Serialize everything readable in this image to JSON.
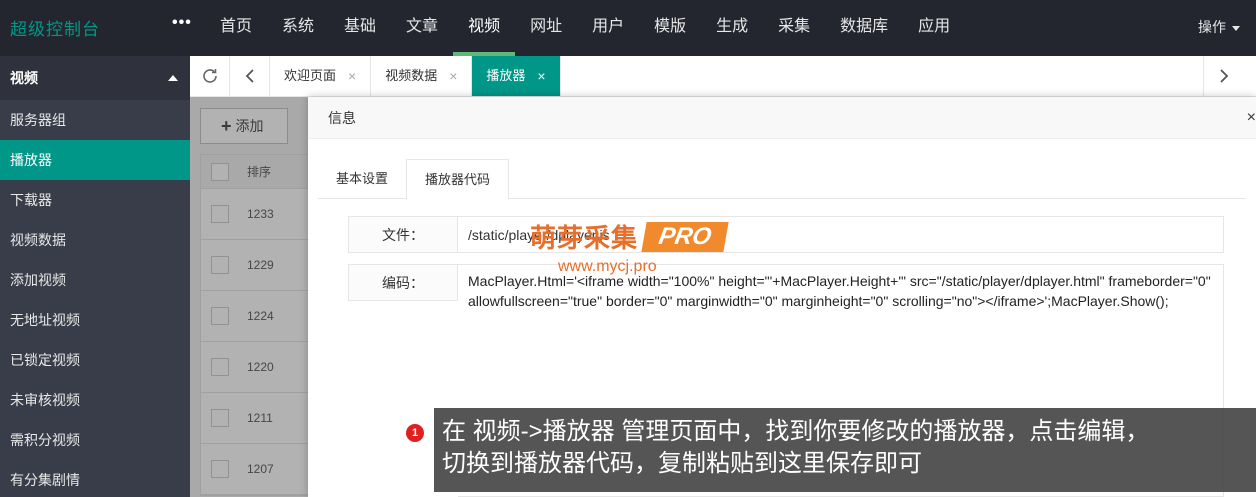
{
  "header": {
    "logo": "超级控制台",
    "more": "•••",
    "nav": [
      "首页",
      "系统",
      "基础",
      "文章",
      "视频",
      "网址",
      "用户",
      "模版",
      "生成",
      "采集",
      "数据库",
      "应用"
    ],
    "active_nav": "视频",
    "ops_label": "操作"
  },
  "sidebar": {
    "section": "视频",
    "items": [
      "服务器组",
      "播放器",
      "下载器",
      "视频数据",
      "添加视频",
      "无地址视频",
      "已锁定视频",
      "未审核视频",
      "需积分视频",
      "有分集剧情"
    ],
    "active_item": "播放器"
  },
  "tabs": {
    "items": [
      "欢迎页面",
      "视频数据",
      "播放器"
    ],
    "active": "播放器",
    "close": "×"
  },
  "list": {
    "add_label": "添加",
    "sort_header": "排序",
    "rows": [
      "1233",
      "1229",
      "1224",
      "1220",
      "1211",
      "1207"
    ]
  },
  "modal": {
    "title": "信息",
    "close": "×",
    "tabs": [
      "基本设置",
      "播放器代码"
    ],
    "active_tab": "播放器代码",
    "file_label": "文件：",
    "file_value": "/static/player/dplayer.js",
    "code_label": "编码：",
    "code_value": "MacPlayer.Html='<iframe width=\"100%\" height=\"'+MacPlayer.Height+'\" src=\"/static/player/dplayer.html\" frameborder=\"0\" allowfullscreen=\"true\" border=\"0\" marginwidth=\"0\" marginheight=\"0\" scrolling=\"no\"></iframe>';MacPlayer.Show();"
  },
  "watermark": {
    "brand": "萌芽采集",
    "pro": "PRO",
    "url": "www.mycj.pro"
  },
  "annotation": {
    "number": "1",
    "text_line1": "在 视频->播放器 管理页面中，找到你要修改的播放器，点击编辑，",
    "text_line2": "切换到播放器代码，复制粘贴到这里保存即可"
  },
  "colors": {
    "topbar": "#23262e",
    "sidebar": "#393d49",
    "accent": "#009688",
    "nav_indicator": "#5fb878"
  }
}
